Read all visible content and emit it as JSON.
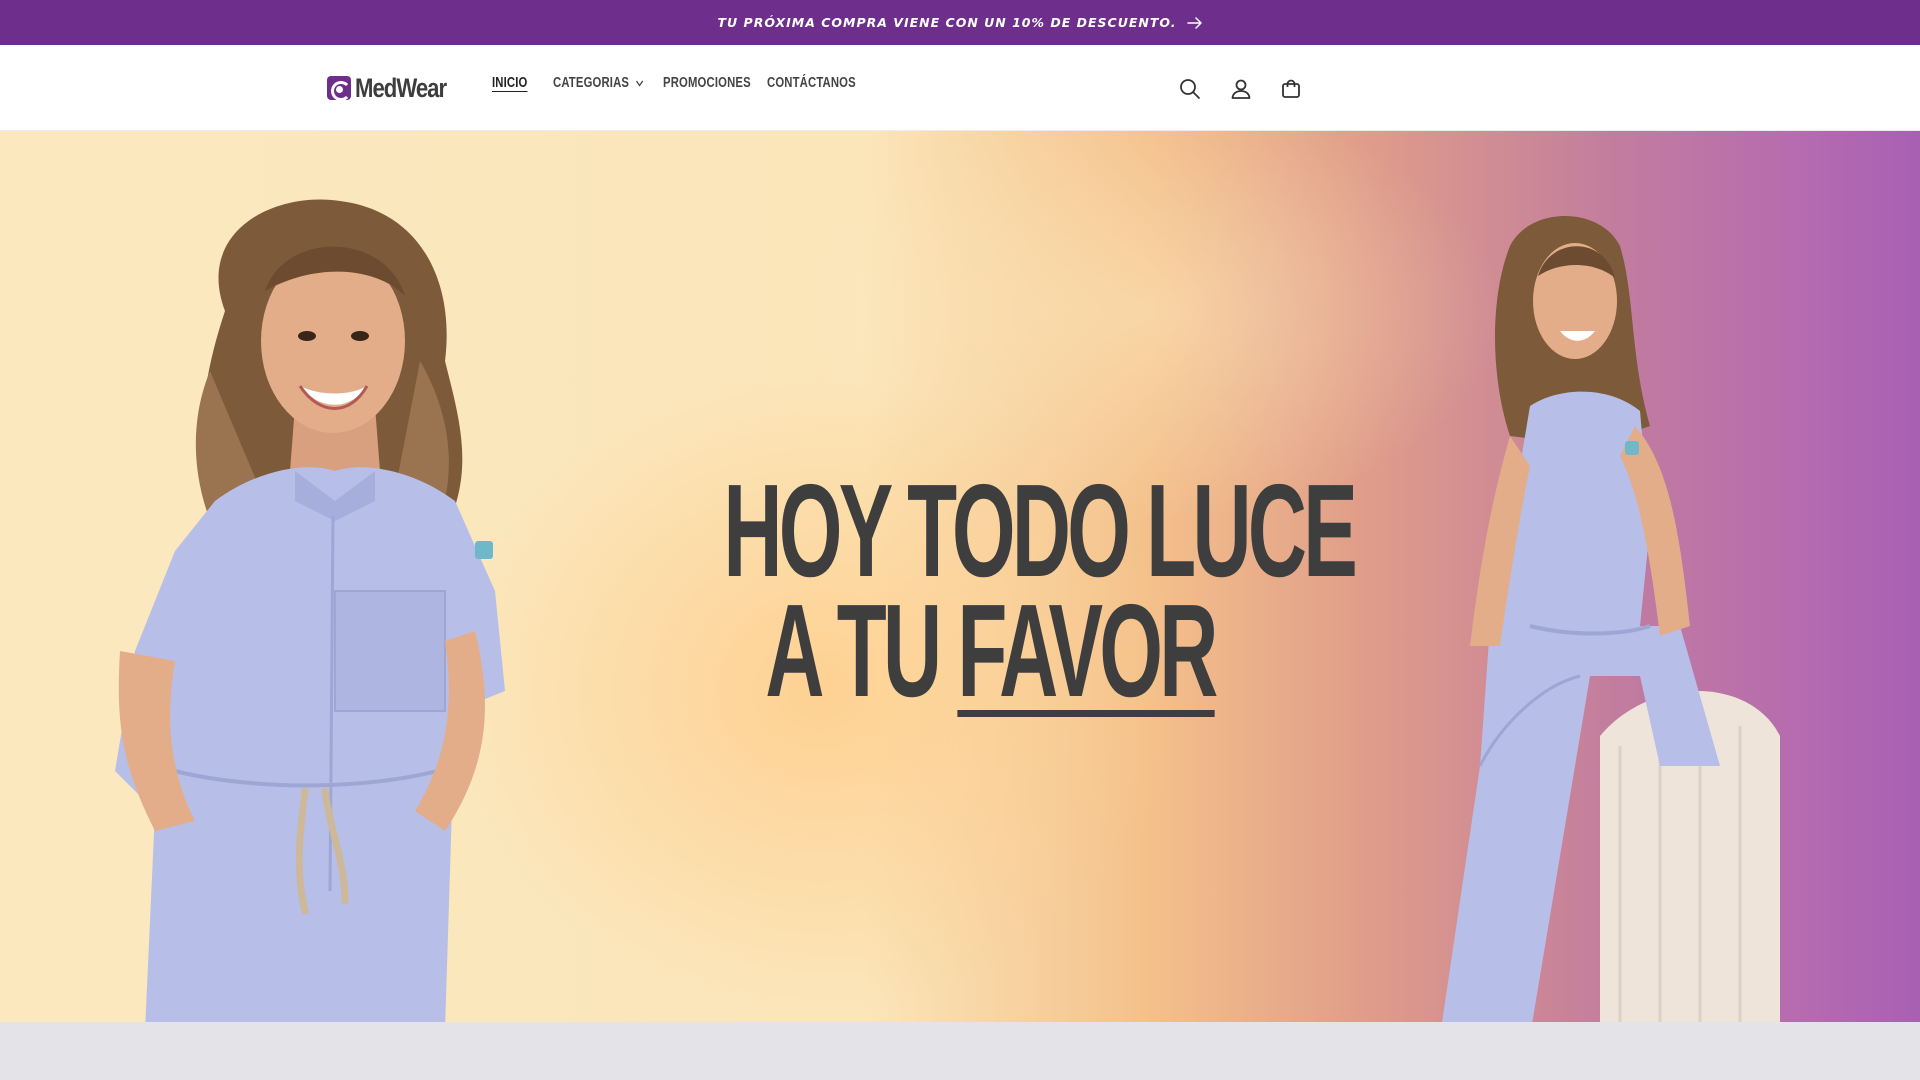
{
  "announcement": {
    "text": "TU PRÓXIMA COMPRA VIENE CON UN 10% DE DESCUENTO.",
    "arrow_icon": "arrow-right-icon"
  },
  "header": {
    "logo_text": "MedWear",
    "nav": [
      {
        "label": "INICIO",
        "active": true
      },
      {
        "label": "CATEGORIAS",
        "has_dropdown": true
      },
      {
        "label": "PROMOCIONES"
      },
      {
        "label": "CONTÁCTANOS"
      }
    ],
    "icons": [
      "search-icon",
      "account-icon",
      "cart-icon"
    ]
  },
  "hero": {
    "headline_line1": "HOY TODO LUCE",
    "headline_line2_prefix": "A TU ",
    "headline_line2_underlined": "FAVOR"
  },
  "colors": {
    "brand_purple": "#6d2f8b",
    "headline": "#3e3e3e",
    "scrubs": "#b7bfe8"
  }
}
